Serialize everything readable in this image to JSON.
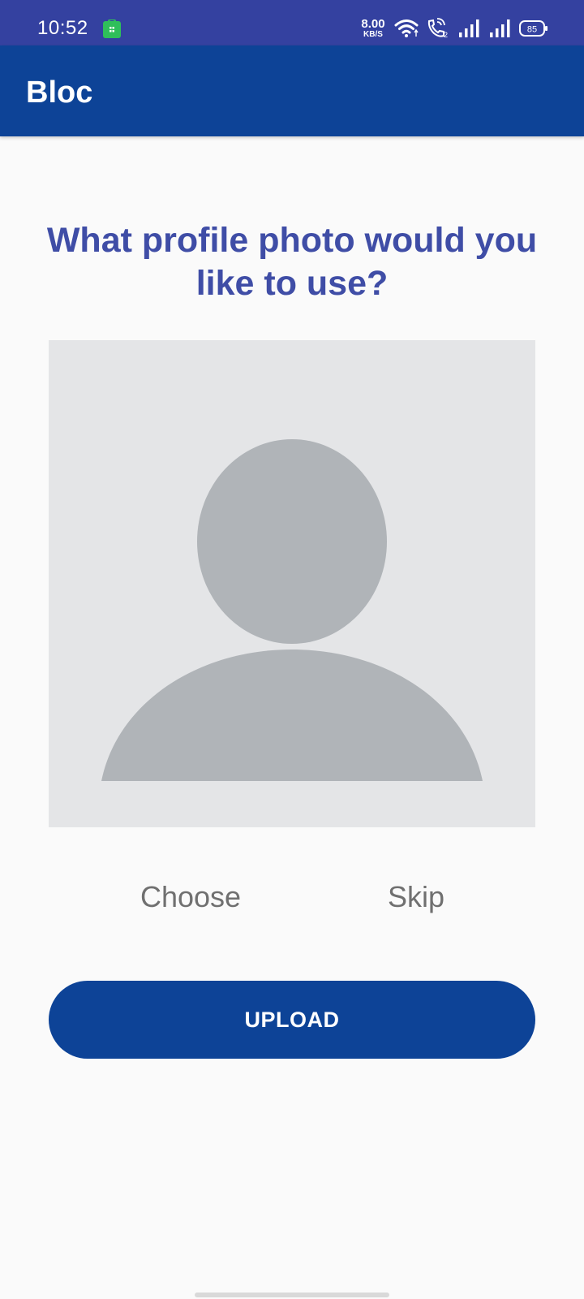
{
  "status_bar": {
    "time": "10:52",
    "app_icon": "shopping-bag-icon",
    "net_speed_value": "8.00",
    "net_speed_unit": "KB/S",
    "battery_level": "85",
    "icons": [
      "wifi-icon",
      "volte-call-icon",
      "signal-icon",
      "signal-icon",
      "battery-icon"
    ]
  },
  "app_bar": {
    "title": "Bloc"
  },
  "main": {
    "question": "What profile photo would you like to use?",
    "placeholder_icon": "person-placeholder-icon",
    "choose_label": "Choose",
    "skip_label": "Skip",
    "upload_label": "UPLOAD"
  },
  "colors": {
    "status_bar": "#3441a0",
    "primary": "#0d4397",
    "question_text": "#3f4da6",
    "placeholder_bg": "#e4e5e7",
    "placeholder_fg": "#b0b4b8",
    "secondary_text": "#707070"
  }
}
